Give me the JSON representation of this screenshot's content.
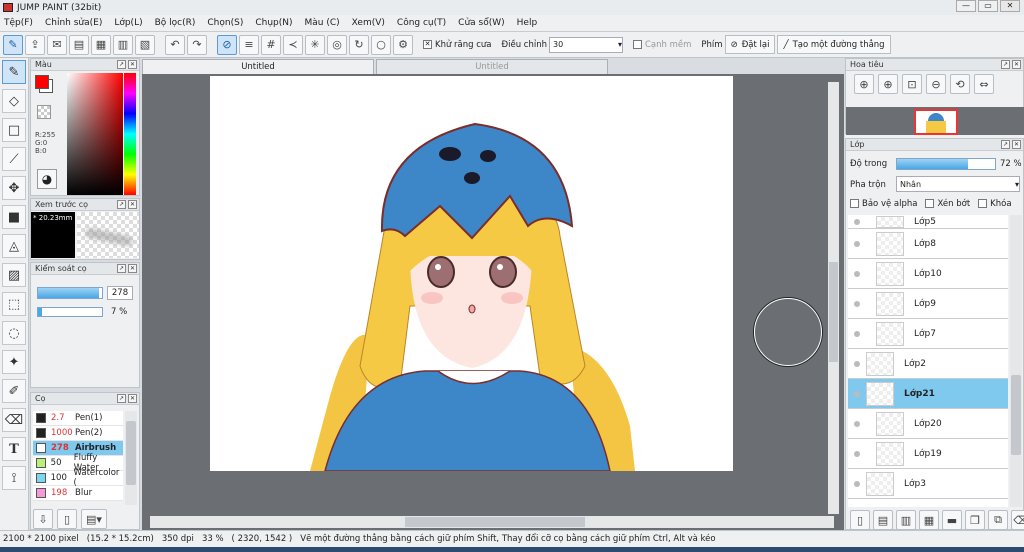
{
  "window": {
    "title": "JUMP PAINT (32bit)",
    "min": "—",
    "max": "▭",
    "close": "✕"
  },
  "menu": [
    "Tệp(F)",
    "Chỉnh sửa(E)",
    "Lớp(L)",
    "Bộ lọc(R)",
    "Chọn(S)",
    "Chụp(N)",
    "Màu (C)",
    "Xem(V)",
    "Công cụ(T)",
    "Cửa sổ(W)",
    "Help"
  ],
  "toolbar": {
    "antialias_label": "Khử răng cưa",
    "adjust_label": "Điều chỉnh",
    "adjust_value": "30",
    "edge_label": "Cạnh mềm",
    "key_label": "Phím",
    "reset_label": "Đặt lại",
    "line_label": "Tạo một đường thẳng"
  },
  "color_panel": {
    "title": "Màu",
    "r": "R:255",
    "g": "G:0",
    "b": "B:0",
    "fg": "#ff0000",
    "bg": "#ffffff"
  },
  "preview_panel": {
    "title": "Xem trước cọ",
    "size": "20.23mm"
  },
  "brush_control": {
    "title": "Kiểm soát cọ",
    "size_value": "278",
    "opacity_value": "7 %",
    "size_fill": 0.95,
    "opacity_fill": 0.07
  },
  "brush_panel": {
    "title": "Cọ",
    "items": [
      {
        "size": "2.7",
        "name": "Pen(1)",
        "color": "#222222"
      },
      {
        "size": "1000",
        "name": "Pen(2)",
        "color": "#222222"
      },
      {
        "size": "278",
        "name": "Airbrush",
        "color": "#ffffff"
      },
      {
        "size": "50",
        "name": "Fluffy Water",
        "color": "#b8f07a"
      },
      {
        "size": "100",
        "name": "Watercolor (",
        "color": "#7ad7ef"
      },
      {
        "size": "198",
        "name": "Blur",
        "color": "#f59ad6"
      }
    ]
  },
  "tabs": {
    "active": "Untitled",
    "inactive": "Untitled"
  },
  "navigator": {
    "title": "Hoa tiêu"
  },
  "layers_panel": {
    "title": "Lớp",
    "opacity_label": "Độ trong",
    "opacity_value": "72 %",
    "opacity_fill": 0.72,
    "blend_label": "Pha trộn",
    "blend_value": "Nhân",
    "protect_alpha": "Bảo vệ alpha",
    "clip": "Xén bớt",
    "lock": "Khóa",
    "layers": [
      "Lớp5",
      "Lớp8",
      "Lớp10",
      "Lớp9",
      "Lớp7",
      "Lớp2",
      "Lớp21",
      "Lớp20",
      "Lớp19",
      "Lớp3"
    ]
  },
  "status": {
    "size": "2100 * 2100 pixel",
    "cm": "(15.2 * 15.2cm)",
    "dpi": "350 dpi",
    "zoom": "33 %",
    "coords": "( 2320, 1542 )",
    "hint": "Vẽ một đường thẳng bằng cách giữ phím Shift, Thay đổi cỡ cọ bằng cách giữ phím Ctrl, Alt và kéo"
  }
}
